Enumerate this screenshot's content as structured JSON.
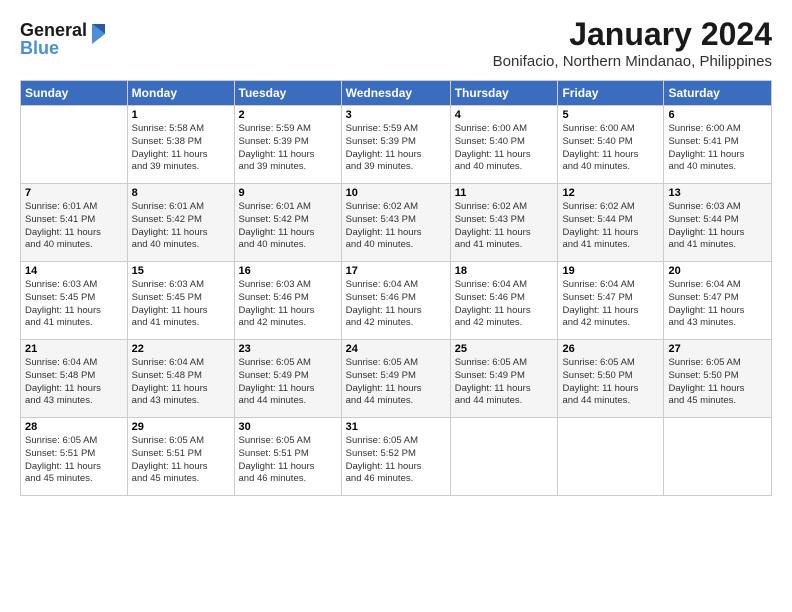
{
  "logo": {
    "line1": "General",
    "line2": "Blue"
  },
  "title": "January 2024",
  "location": "Bonifacio, Northern Mindanao, Philippines",
  "days_of_week": [
    "Sunday",
    "Monday",
    "Tuesday",
    "Wednesday",
    "Thursday",
    "Friday",
    "Saturday"
  ],
  "weeks": [
    [
      {
        "day": "",
        "info": ""
      },
      {
        "day": "1",
        "info": "Sunrise: 5:58 AM\nSunset: 5:38 PM\nDaylight: 11 hours\nand 39 minutes."
      },
      {
        "day": "2",
        "info": "Sunrise: 5:59 AM\nSunset: 5:39 PM\nDaylight: 11 hours\nand 39 minutes."
      },
      {
        "day": "3",
        "info": "Sunrise: 5:59 AM\nSunset: 5:39 PM\nDaylight: 11 hours\nand 39 minutes."
      },
      {
        "day": "4",
        "info": "Sunrise: 6:00 AM\nSunset: 5:40 PM\nDaylight: 11 hours\nand 40 minutes."
      },
      {
        "day": "5",
        "info": "Sunrise: 6:00 AM\nSunset: 5:40 PM\nDaylight: 11 hours\nand 40 minutes."
      },
      {
        "day": "6",
        "info": "Sunrise: 6:00 AM\nSunset: 5:41 PM\nDaylight: 11 hours\nand 40 minutes."
      }
    ],
    [
      {
        "day": "7",
        "info": "Sunrise: 6:01 AM\nSunset: 5:41 PM\nDaylight: 11 hours\nand 40 minutes."
      },
      {
        "day": "8",
        "info": "Sunrise: 6:01 AM\nSunset: 5:42 PM\nDaylight: 11 hours\nand 40 minutes."
      },
      {
        "day": "9",
        "info": "Sunrise: 6:01 AM\nSunset: 5:42 PM\nDaylight: 11 hours\nand 40 minutes."
      },
      {
        "day": "10",
        "info": "Sunrise: 6:02 AM\nSunset: 5:43 PM\nDaylight: 11 hours\nand 40 minutes."
      },
      {
        "day": "11",
        "info": "Sunrise: 6:02 AM\nSunset: 5:43 PM\nDaylight: 11 hours\nand 41 minutes."
      },
      {
        "day": "12",
        "info": "Sunrise: 6:02 AM\nSunset: 5:44 PM\nDaylight: 11 hours\nand 41 minutes."
      },
      {
        "day": "13",
        "info": "Sunrise: 6:03 AM\nSunset: 5:44 PM\nDaylight: 11 hours\nand 41 minutes."
      }
    ],
    [
      {
        "day": "14",
        "info": "Sunrise: 6:03 AM\nSunset: 5:45 PM\nDaylight: 11 hours\nand 41 minutes."
      },
      {
        "day": "15",
        "info": "Sunrise: 6:03 AM\nSunset: 5:45 PM\nDaylight: 11 hours\nand 41 minutes."
      },
      {
        "day": "16",
        "info": "Sunrise: 6:03 AM\nSunset: 5:46 PM\nDaylight: 11 hours\nand 42 minutes."
      },
      {
        "day": "17",
        "info": "Sunrise: 6:04 AM\nSunset: 5:46 PM\nDaylight: 11 hours\nand 42 minutes."
      },
      {
        "day": "18",
        "info": "Sunrise: 6:04 AM\nSunset: 5:46 PM\nDaylight: 11 hours\nand 42 minutes."
      },
      {
        "day": "19",
        "info": "Sunrise: 6:04 AM\nSunset: 5:47 PM\nDaylight: 11 hours\nand 42 minutes."
      },
      {
        "day": "20",
        "info": "Sunrise: 6:04 AM\nSunset: 5:47 PM\nDaylight: 11 hours\nand 43 minutes."
      }
    ],
    [
      {
        "day": "21",
        "info": "Sunrise: 6:04 AM\nSunset: 5:48 PM\nDaylight: 11 hours\nand 43 minutes."
      },
      {
        "day": "22",
        "info": "Sunrise: 6:04 AM\nSunset: 5:48 PM\nDaylight: 11 hours\nand 43 minutes."
      },
      {
        "day": "23",
        "info": "Sunrise: 6:05 AM\nSunset: 5:49 PM\nDaylight: 11 hours\nand 44 minutes."
      },
      {
        "day": "24",
        "info": "Sunrise: 6:05 AM\nSunset: 5:49 PM\nDaylight: 11 hours\nand 44 minutes."
      },
      {
        "day": "25",
        "info": "Sunrise: 6:05 AM\nSunset: 5:49 PM\nDaylight: 11 hours\nand 44 minutes."
      },
      {
        "day": "26",
        "info": "Sunrise: 6:05 AM\nSunset: 5:50 PM\nDaylight: 11 hours\nand 44 minutes."
      },
      {
        "day": "27",
        "info": "Sunrise: 6:05 AM\nSunset: 5:50 PM\nDaylight: 11 hours\nand 45 minutes."
      }
    ],
    [
      {
        "day": "28",
        "info": "Sunrise: 6:05 AM\nSunset: 5:51 PM\nDaylight: 11 hours\nand 45 minutes."
      },
      {
        "day": "29",
        "info": "Sunrise: 6:05 AM\nSunset: 5:51 PM\nDaylight: 11 hours\nand 45 minutes."
      },
      {
        "day": "30",
        "info": "Sunrise: 6:05 AM\nSunset: 5:51 PM\nDaylight: 11 hours\nand 46 minutes."
      },
      {
        "day": "31",
        "info": "Sunrise: 6:05 AM\nSunset: 5:52 PM\nDaylight: 11 hours\nand 46 minutes."
      },
      {
        "day": "",
        "info": ""
      },
      {
        "day": "",
        "info": ""
      },
      {
        "day": "",
        "info": ""
      }
    ]
  ]
}
